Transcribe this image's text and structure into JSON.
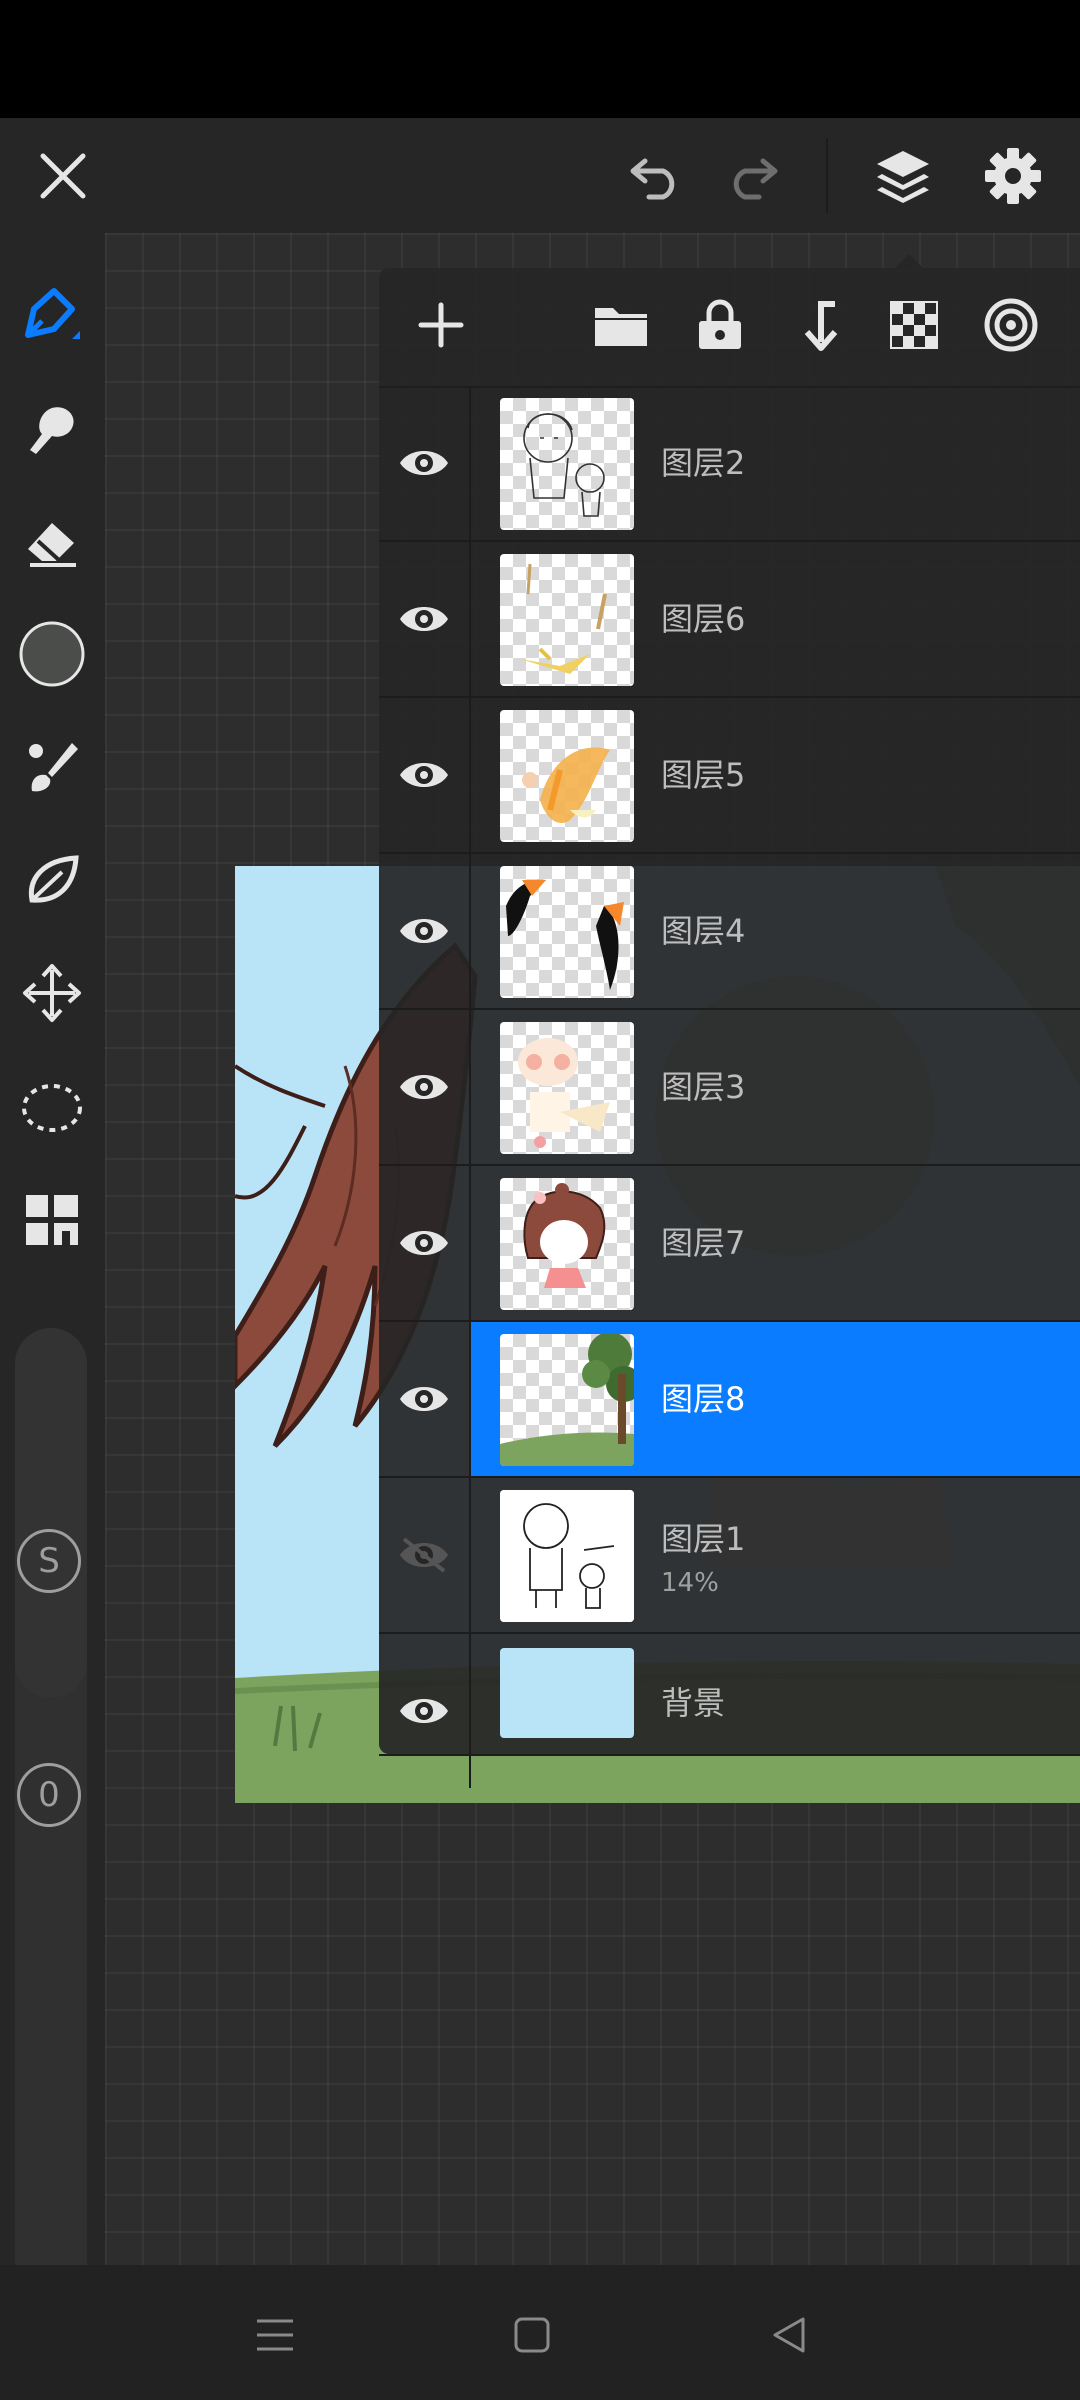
{
  "app": {
    "accent_color": "#0a7cff",
    "top_bar": {
      "close": "close-icon",
      "undo": "undo-icon",
      "redo": "redo-icon",
      "layers": "layers-icon",
      "settings": "gear-icon"
    },
    "tools": [
      {
        "name": "pen-tool",
        "icon": "pen-icon",
        "active": true
      },
      {
        "name": "smudge-tool",
        "icon": "smudge-icon"
      },
      {
        "name": "eraser-tool",
        "icon": "eraser-icon"
      },
      {
        "name": "color-picker",
        "icon": "color-swatch",
        "color": "#4a4d4a"
      },
      {
        "name": "brush-tool",
        "icon": "brush-icon"
      },
      {
        "name": "leaf-tool",
        "icon": "leaf-icon"
      },
      {
        "name": "transform-tool",
        "icon": "move-icon"
      },
      {
        "name": "lasso-tool",
        "icon": "lasso-icon"
      },
      {
        "name": "gallery-tool",
        "icon": "grid-icon"
      }
    ],
    "sliders": {
      "size_label": "S",
      "opacity_label": "0"
    }
  },
  "layers_panel": {
    "toolbar": [
      "add-icon",
      "folder-icon",
      "lock-icon",
      "merge-down-icon",
      "transparency-icon",
      "blend-icon"
    ],
    "layers": [
      {
        "name": "图层2",
        "visible": true,
        "selected": false,
        "opacity": ""
      },
      {
        "name": "图层6",
        "visible": true,
        "selected": false,
        "opacity": ""
      },
      {
        "name": "图层5",
        "visible": true,
        "selected": false,
        "opacity": ""
      },
      {
        "name": "图层4",
        "visible": true,
        "selected": false,
        "opacity": ""
      },
      {
        "name": "图层3",
        "visible": true,
        "selected": false,
        "opacity": ""
      },
      {
        "name": "图层7",
        "visible": true,
        "selected": false,
        "opacity": ""
      },
      {
        "name": "图层8",
        "visible": true,
        "selected": true,
        "opacity": ""
      },
      {
        "name": "图层1",
        "visible": false,
        "selected": false,
        "opacity": "14%"
      },
      {
        "name": "背景",
        "visible": true,
        "selected": false,
        "opacity": "",
        "fill": "#b9e4f7"
      }
    ]
  },
  "nav": {
    "menu": "menu-icon",
    "home": "home-icon",
    "back": "back-icon"
  }
}
